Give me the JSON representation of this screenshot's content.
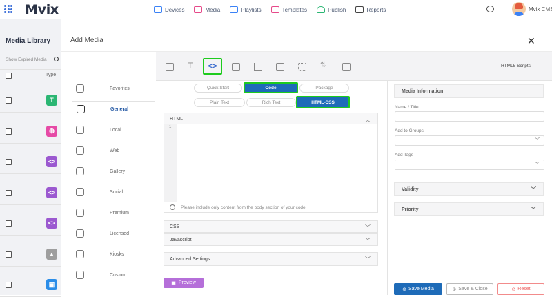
{
  "app": {
    "logo": "Mvix",
    "user": "Mvix CMS"
  },
  "nav": [
    "Devices",
    "Media",
    "Playlists",
    "Templates",
    "Publish",
    "Reports"
  ],
  "library": {
    "title": "Media Library",
    "show_expired": "Show Expired Media",
    "type_header": "Type",
    "tiles": [
      {
        "icon": "text-T-icon",
        "glyph": "T",
        "color": "#2bb673"
      },
      {
        "icon": "pink-media-icon",
        "glyph": "◍",
        "color": "#e64aa6"
      },
      {
        "icon": "code-icon",
        "glyph": "<>",
        "color": "#9b59d0"
      },
      {
        "icon": "code-icon",
        "glyph": "<>",
        "color": "#9b59d0"
      },
      {
        "icon": "code-icon",
        "glyph": "<>",
        "color": "#9b59d0"
      },
      {
        "icon": "gdrive-icon",
        "glyph": "▲",
        "color": "#9e9e9e"
      },
      {
        "icon": "folder-icon",
        "glyph": "▣",
        "color": "#2b8de8"
      }
    ]
  },
  "modal": {
    "title": "Add Media",
    "sources": [
      "Favorites",
      "General",
      "Local",
      "Web",
      "Gallery",
      "Social",
      "Premium",
      "Licensed",
      "Kiosks",
      "Custom"
    ],
    "active_source": "General",
    "toolbar_title": "HTML5 Scripts",
    "toolbar_selected": "<>",
    "mode_tabs": [
      "Quick Start",
      "Code",
      "Package"
    ],
    "active_mode": "Code",
    "format_tabs": [
      "Plain Text",
      "Rich Text",
      "HTML-CSS"
    ],
    "active_format": "HTML-CSS",
    "html_label": "HTML",
    "line_number": "1",
    "note": "Please include only content from the body section of your code.",
    "css_label": "CSS",
    "js_label": "Javascript",
    "advanced_label": "Advanced Settings",
    "preview_label": "Preview"
  },
  "info": {
    "header": "Media Information",
    "name_label": "Name / Title",
    "groups_label": "Add to Groups",
    "tags_label": "Add Tags",
    "validity": "Validity",
    "priority": "Priority",
    "save_media": "Save Media",
    "save_close": "Save & Close",
    "reset": "Reset"
  },
  "colors": {
    "primary": "#1e6bb8",
    "highlight": "#1ecb1e",
    "preview": "#b56fd9"
  }
}
